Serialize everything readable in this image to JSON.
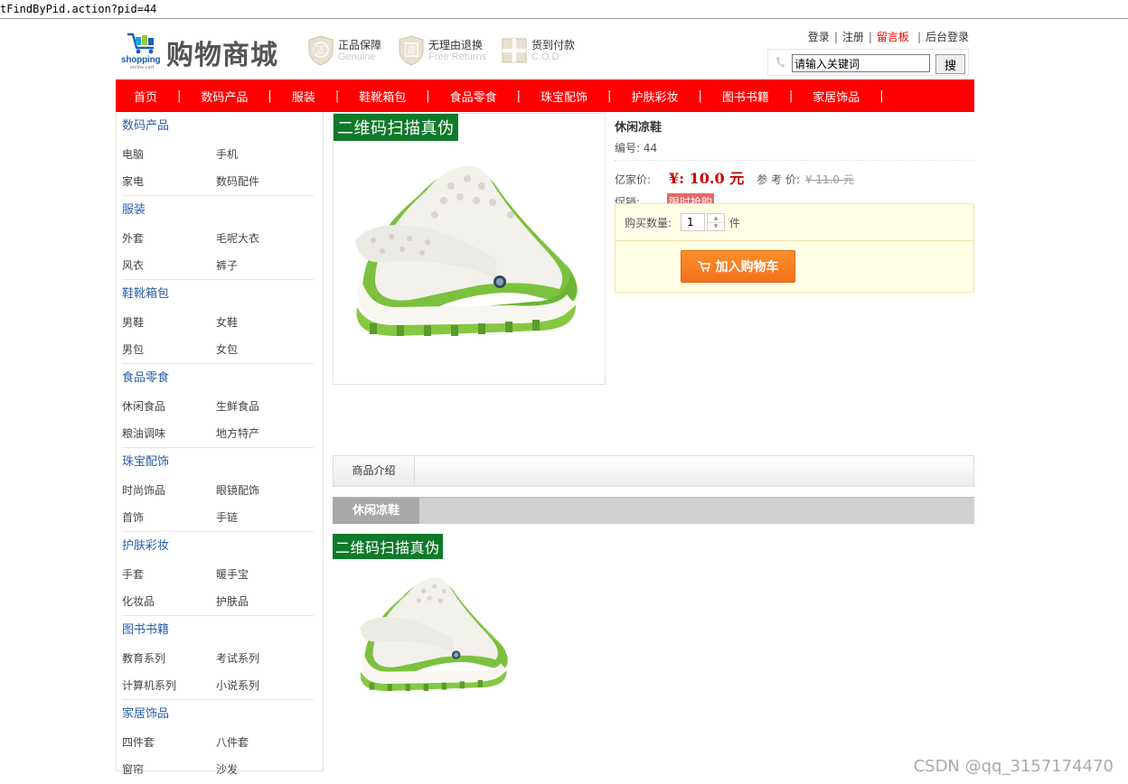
{
  "browser": {
    "url_fragment": "tFindByPid.action?pid=44"
  },
  "header": {
    "logo_word": "shopping",
    "logo_sub": "online cart",
    "site_title": "购物商城",
    "promises": [
      {
        "cn": "正品保障",
        "en": "Genuine",
        "badge": "正"
      },
      {
        "cn": "无理由退换",
        "en": "Free Returns",
        "badge": "退"
      },
      {
        "cn": "货到付款",
        "en": "C.O.D",
        "badge": "货"
      }
    ],
    "links": {
      "login": "登录",
      "register": "注册",
      "guestbook": "留言板",
      "admin_login": "后台登录"
    },
    "search": {
      "value": "请输入关键词",
      "button": "搜"
    }
  },
  "nav": [
    "首页",
    "数码产品",
    "服装",
    "鞋靴箱包",
    "食品零食",
    "珠宝配饰",
    "护肤彩妆",
    "图书书籍",
    "家居饰品"
  ],
  "sidebar": [
    {
      "title": "数码产品",
      "items": [
        "电脑",
        "手机",
        "家电",
        "数码配件"
      ]
    },
    {
      "title": "服装",
      "items": [
        "外套",
        "毛呢大衣",
        "风衣",
        "裤子"
      ]
    },
    {
      "title": "鞋靴箱包",
      "items": [
        "男鞋",
        "女鞋",
        "男包",
        "女包"
      ]
    },
    {
      "title": "食品零食",
      "items": [
        "休闲食品",
        "生鲜食品",
        "粮油调味",
        "地方特产"
      ]
    },
    {
      "title": "珠宝配饰",
      "items": [
        "时尚饰品",
        "眼镜配饰",
        "首饰",
        "手链"
      ]
    },
    {
      "title": "护肤彩妆",
      "items": [
        "手套",
        "暖手宝",
        "化妆品",
        "护肤品"
      ]
    },
    {
      "title": "图书书籍",
      "items": [
        "教育系列",
        "考试系列",
        "计算机系列",
        "小说系列"
      ]
    },
    {
      "title": "家居饰品",
      "items": [
        "四件套",
        "八件套",
        "窗帘",
        "沙发"
      ]
    }
  ],
  "product": {
    "qr_tag": "二维码扫描真伪",
    "name": "休闲凉鞋",
    "no_label": "编号:",
    "no_value": "44",
    "sale_label": "亿家价:",
    "sale_price": "¥: 10.0 元",
    "ref_label": "参 考 价:",
    "ref_price": "¥ 11.0 元",
    "promo_label": "促销:",
    "promo_tag": "限时抢购",
    "qty_label": "购买数量:",
    "qty_value": "1",
    "qty_unit": "件",
    "cart_button": "加入购物车"
  },
  "tabs": {
    "intro": "商品介绍"
  },
  "detail": {
    "title": "休闲凉鞋",
    "qr_tag": "二维码扫描真伪"
  },
  "watermark": "CSDN @qq_3157174470",
  "colors": {
    "nav": "#ff0000",
    "link_blue": "#2a5ea8",
    "price_red": "#cc0000",
    "cart_orange": "#f4701c"
  }
}
